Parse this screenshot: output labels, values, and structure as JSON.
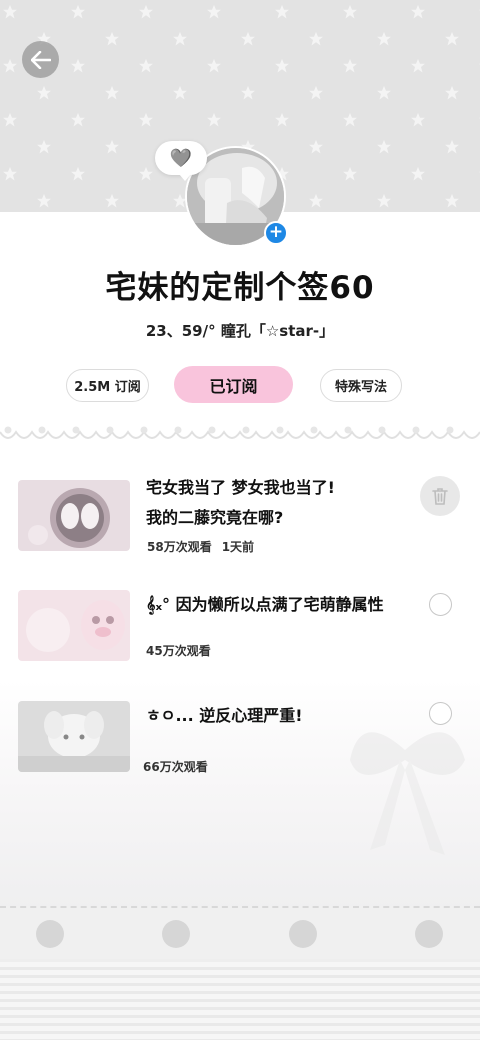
{
  "header": {
    "back_label": "back",
    "heart_emoji": "🩶"
  },
  "profile": {
    "title": "宅妹的定制个签60",
    "subtitle": "23、59/°  瞳孔「☆star-」",
    "subscribers": "2.5M 订阅",
    "subscribe_button": "已订阅",
    "style_tag": "特殊写法"
  },
  "items": [
    {
      "title_line1": "宅女我当了  梦女我也当了!",
      "title_line2": "我的二藤究竟在哪?",
      "views": "58万次观看",
      "time": "1天前"
    },
    {
      "title_line1": "𝄞ₓ° 因为懒所以点满了宅萌静属性",
      "views": "45万次观看"
    },
    {
      "title_line1": "ㅎㅇ... 逆反心理严重!",
      "views": "66万次观看"
    }
  ],
  "colors": {
    "accent_pink": "#f9c4dc",
    "plus_blue": "#1e88e5",
    "header_gray": "#e3e3e3"
  }
}
